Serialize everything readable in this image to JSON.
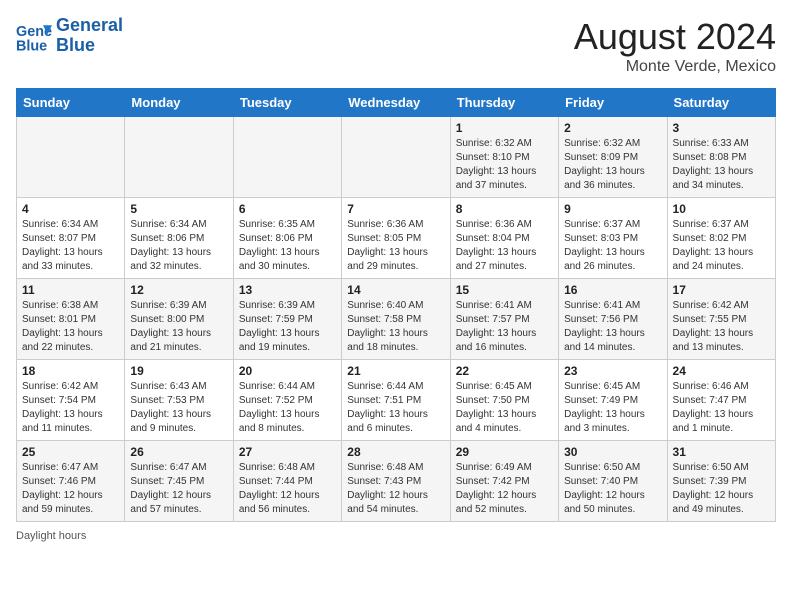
{
  "header": {
    "logo_line1": "General",
    "logo_line2": "Blue",
    "month_year": "August 2024",
    "location": "Monte Verde, Mexico"
  },
  "days_of_week": [
    "Sunday",
    "Monday",
    "Tuesday",
    "Wednesday",
    "Thursday",
    "Friday",
    "Saturday"
  ],
  "weeks": [
    [
      {
        "day": "",
        "info": ""
      },
      {
        "day": "",
        "info": ""
      },
      {
        "day": "",
        "info": ""
      },
      {
        "day": "",
        "info": ""
      },
      {
        "day": "1",
        "info": "Sunrise: 6:32 AM\nSunset: 8:10 PM\nDaylight: 13 hours and 37 minutes."
      },
      {
        "day": "2",
        "info": "Sunrise: 6:32 AM\nSunset: 8:09 PM\nDaylight: 13 hours and 36 minutes."
      },
      {
        "day": "3",
        "info": "Sunrise: 6:33 AM\nSunset: 8:08 PM\nDaylight: 13 hours and 34 minutes."
      }
    ],
    [
      {
        "day": "4",
        "info": "Sunrise: 6:34 AM\nSunset: 8:07 PM\nDaylight: 13 hours and 33 minutes."
      },
      {
        "day": "5",
        "info": "Sunrise: 6:34 AM\nSunset: 8:06 PM\nDaylight: 13 hours and 32 minutes."
      },
      {
        "day": "6",
        "info": "Sunrise: 6:35 AM\nSunset: 8:06 PM\nDaylight: 13 hours and 30 minutes."
      },
      {
        "day": "7",
        "info": "Sunrise: 6:36 AM\nSunset: 8:05 PM\nDaylight: 13 hours and 29 minutes."
      },
      {
        "day": "8",
        "info": "Sunrise: 6:36 AM\nSunset: 8:04 PM\nDaylight: 13 hours and 27 minutes."
      },
      {
        "day": "9",
        "info": "Sunrise: 6:37 AM\nSunset: 8:03 PM\nDaylight: 13 hours and 26 minutes."
      },
      {
        "day": "10",
        "info": "Sunrise: 6:37 AM\nSunset: 8:02 PM\nDaylight: 13 hours and 24 minutes."
      }
    ],
    [
      {
        "day": "11",
        "info": "Sunrise: 6:38 AM\nSunset: 8:01 PM\nDaylight: 13 hours and 22 minutes."
      },
      {
        "day": "12",
        "info": "Sunrise: 6:39 AM\nSunset: 8:00 PM\nDaylight: 13 hours and 21 minutes."
      },
      {
        "day": "13",
        "info": "Sunrise: 6:39 AM\nSunset: 7:59 PM\nDaylight: 13 hours and 19 minutes."
      },
      {
        "day": "14",
        "info": "Sunrise: 6:40 AM\nSunset: 7:58 PM\nDaylight: 13 hours and 18 minutes."
      },
      {
        "day": "15",
        "info": "Sunrise: 6:41 AM\nSunset: 7:57 PM\nDaylight: 13 hours and 16 minutes."
      },
      {
        "day": "16",
        "info": "Sunrise: 6:41 AM\nSunset: 7:56 PM\nDaylight: 13 hours and 14 minutes."
      },
      {
        "day": "17",
        "info": "Sunrise: 6:42 AM\nSunset: 7:55 PM\nDaylight: 13 hours and 13 minutes."
      }
    ],
    [
      {
        "day": "18",
        "info": "Sunrise: 6:42 AM\nSunset: 7:54 PM\nDaylight: 13 hours and 11 minutes."
      },
      {
        "day": "19",
        "info": "Sunrise: 6:43 AM\nSunset: 7:53 PM\nDaylight: 13 hours and 9 minutes."
      },
      {
        "day": "20",
        "info": "Sunrise: 6:44 AM\nSunset: 7:52 PM\nDaylight: 13 hours and 8 minutes."
      },
      {
        "day": "21",
        "info": "Sunrise: 6:44 AM\nSunset: 7:51 PM\nDaylight: 13 hours and 6 minutes."
      },
      {
        "day": "22",
        "info": "Sunrise: 6:45 AM\nSunset: 7:50 PM\nDaylight: 13 hours and 4 minutes."
      },
      {
        "day": "23",
        "info": "Sunrise: 6:45 AM\nSunset: 7:49 PM\nDaylight: 13 hours and 3 minutes."
      },
      {
        "day": "24",
        "info": "Sunrise: 6:46 AM\nSunset: 7:47 PM\nDaylight: 13 hours and 1 minute."
      }
    ],
    [
      {
        "day": "25",
        "info": "Sunrise: 6:47 AM\nSunset: 7:46 PM\nDaylight: 12 hours and 59 minutes."
      },
      {
        "day": "26",
        "info": "Sunrise: 6:47 AM\nSunset: 7:45 PM\nDaylight: 12 hours and 57 minutes."
      },
      {
        "day": "27",
        "info": "Sunrise: 6:48 AM\nSunset: 7:44 PM\nDaylight: 12 hours and 56 minutes."
      },
      {
        "day": "28",
        "info": "Sunrise: 6:48 AM\nSunset: 7:43 PM\nDaylight: 12 hours and 54 minutes."
      },
      {
        "day": "29",
        "info": "Sunrise: 6:49 AM\nSunset: 7:42 PM\nDaylight: 12 hours and 52 minutes."
      },
      {
        "day": "30",
        "info": "Sunrise: 6:50 AM\nSunset: 7:40 PM\nDaylight: 12 hours and 50 minutes."
      },
      {
        "day": "31",
        "info": "Sunrise: 6:50 AM\nSunset: 7:39 PM\nDaylight: 12 hours and 49 minutes."
      }
    ]
  ],
  "footer": {
    "daylight_label": "Daylight hours"
  }
}
